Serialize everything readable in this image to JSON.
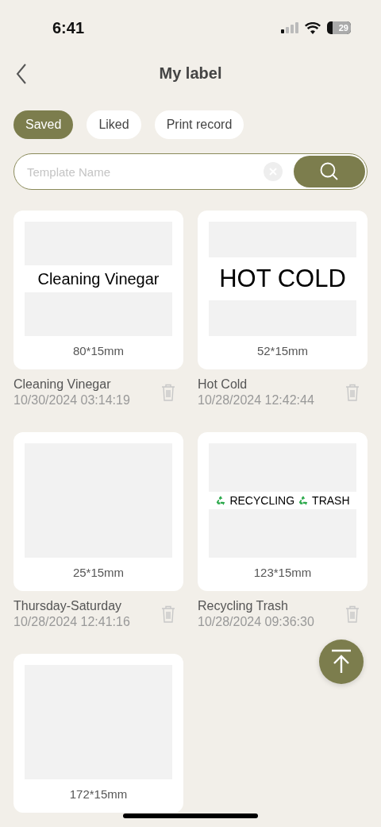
{
  "status_bar": {
    "time": "6:41",
    "battery": "29"
  },
  "header": {
    "title": "My label"
  },
  "tabs": [
    {
      "label": "Saved",
      "selected": true
    },
    {
      "label": "Liked",
      "selected": false
    },
    {
      "label": "Print record",
      "selected": false
    }
  ],
  "search": {
    "placeholder": "Template Name"
  },
  "templates": [
    {
      "name": "Cleaning Vinegar",
      "date": "10/30/2024 03:14:19",
      "size_mm": "80*15mm",
      "preview": {
        "kind": "small",
        "parts": [
          {
            "kind": "text",
            "text": "Cleaning  Vinegar"
          }
        ]
      }
    },
    {
      "size_mm": "52*15mm",
      "name": "Hot Cold",
      "date": "10/28/2024 12:42:44",
      "preview": {
        "kind": "large",
        "parts": [
          {
            "kind": "text",
            "text": "HOT COLD"
          }
        ]
      }
    },
    {
      "size_mm": "25*15mm",
      "name": "Thursday-Saturday",
      "date": "10/28/2024 12:41:16"
    },
    {
      "size_mm": "123*15mm",
      "name": "Recycling Trash",
      "date": "10/28/2024 09:36:30",
      "preview": {
        "kind": "tiny",
        "parts": [
          {
            "kind": "icon"
          },
          {
            "kind": "text",
            "text": "RECYCLING"
          },
          {
            "kind": "icon"
          },
          {
            "kind": "text",
            "text": "TRASH"
          }
        ]
      }
    },
    {
      "size_mm": "172*15mm"
    }
  ]
}
